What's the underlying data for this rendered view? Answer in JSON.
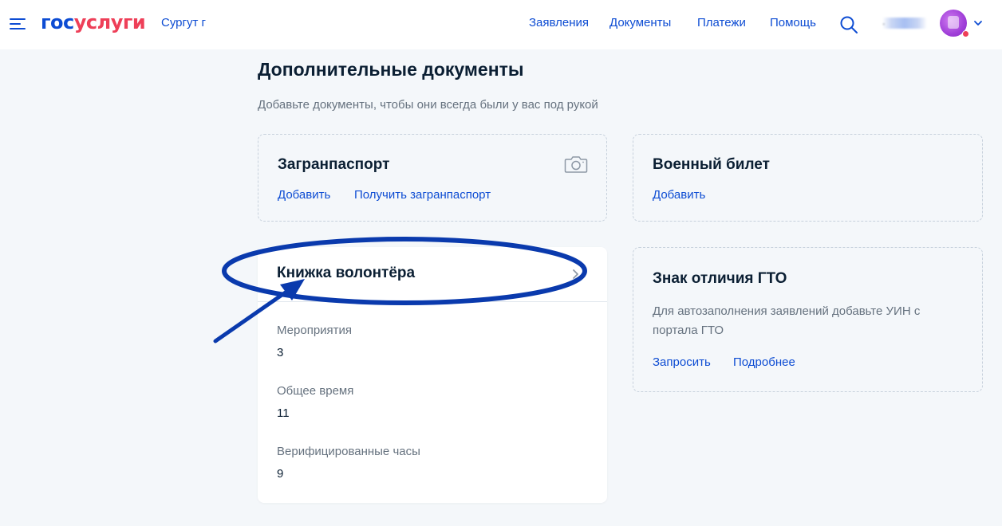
{
  "header": {
    "logo_part1": "гос",
    "logo_part2": "услуги",
    "city": "Сургут г",
    "nav": [
      "Заявления",
      "Документы",
      "Платежи",
      "Помощь"
    ],
    "user_name": "."
  },
  "page": {
    "title": "Дополнительные документы",
    "subtitle": "Добавьте документы, чтобы они всегда были у вас под рукой"
  },
  "cards": {
    "passport": {
      "title": "Загранпаспорт",
      "link_add": "Добавить",
      "link_get": "Получить загранпаспорт"
    },
    "military": {
      "title": "Военный билет",
      "link_add": "Добавить"
    },
    "volunteer": {
      "title": "Книжка волонтёра",
      "events_label": "Мероприятия",
      "events_value": "3",
      "time_label": "Общее время",
      "time_value": "11",
      "verified_label": "Верифицированные часы",
      "verified_value": "9"
    },
    "gto": {
      "title": "Знак отличия ГТО",
      "desc_line1": "Для автозаполнения заявлений добавьте УИН с",
      "desc_line2": "портала ГТО",
      "link_request": "Запросить",
      "link_more": "Подробнее"
    }
  },
  "colors": {
    "brand_blue": "#0d4cd3",
    "brand_red": "#ee3f58",
    "annotation_blue": "#0a3aad"
  }
}
